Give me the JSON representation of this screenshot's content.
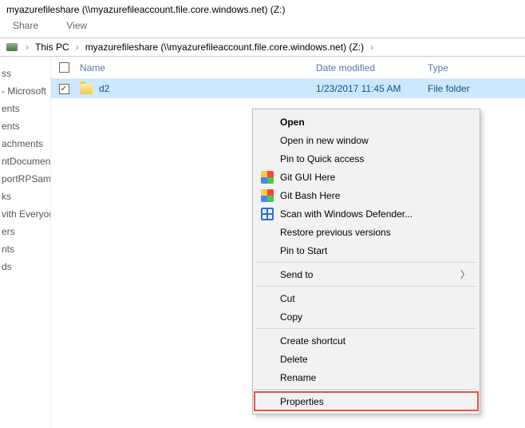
{
  "window": {
    "title": "myazurefileshare (\\\\myazurefileaccount.file.core.windows.net) (Z:)"
  },
  "menu": {
    "share": "Share",
    "view": "View"
  },
  "breadcrumb": {
    "pc": "This PC",
    "share": "myazurefileshare (\\\\myazurefileaccount.file.core.windows.net) (Z:)"
  },
  "nav_items": [
    "ss",
    "- Microsoft",
    "ents",
    "ents",
    "achments",
    "ntDocumen",
    "portRPSam",
    "ks",
    "vith Everyon",
    "ers",
    "",
    "",
    "nts",
    "ds"
  ],
  "columns": {
    "name": "Name",
    "date": "Date modified",
    "type": "Type"
  },
  "rows": [
    {
      "name": "d2",
      "date": "1/23/2017 11:45 AM",
      "type": "File folder",
      "checked": true,
      "selected": true
    }
  ],
  "ctx": {
    "open": "Open",
    "open_new": "Open in new window",
    "pin_qa": "Pin to Quick access",
    "git_gui": "Git GUI Here",
    "git_bash": "Git Bash Here",
    "defender": "Scan with Windows Defender...",
    "restore": "Restore previous versions",
    "pin_start": "Pin to Start",
    "send_to": "Send to",
    "cut": "Cut",
    "copy": "Copy",
    "shortcut": "Create shortcut",
    "delete": "Delete",
    "rename": "Rename",
    "properties": "Properties"
  }
}
